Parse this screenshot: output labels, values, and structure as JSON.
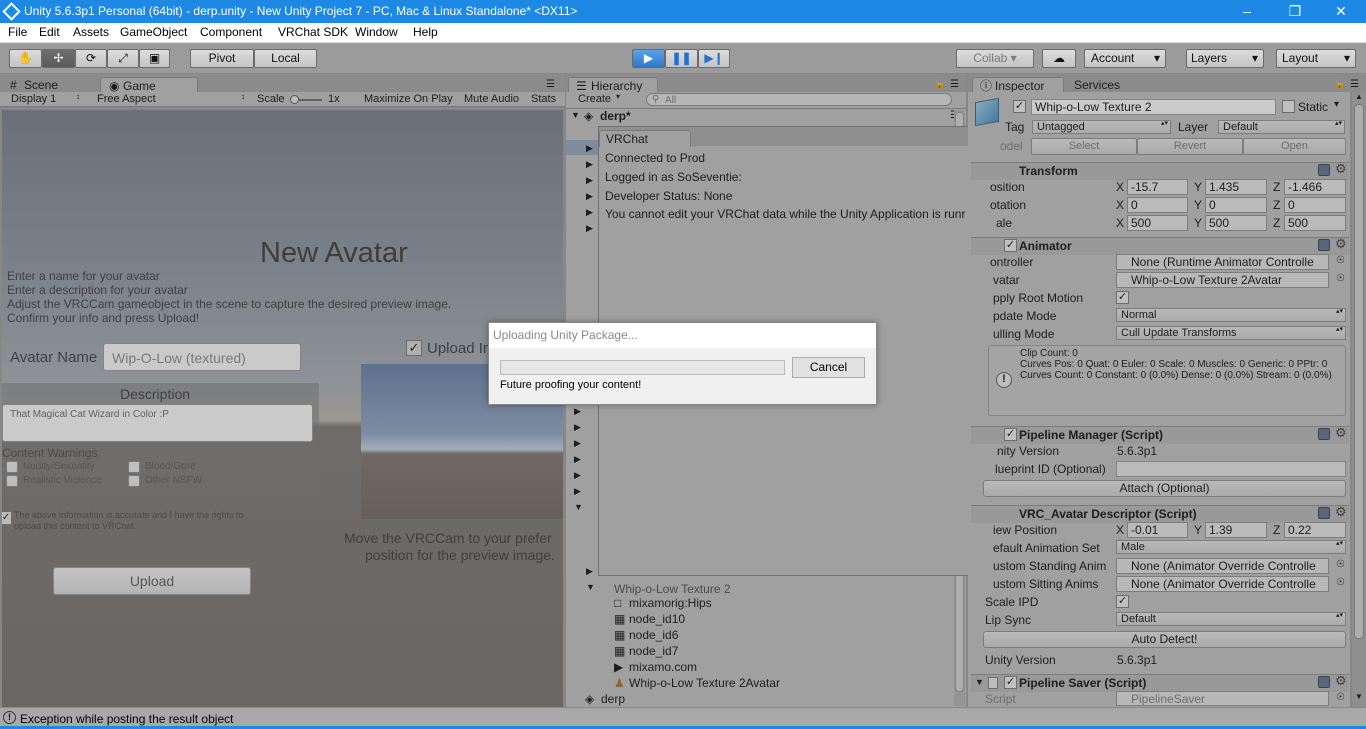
{
  "window": {
    "title": "Unity 5.6.3p1 Personal (64bit) - derp.unity - New Unity Project 7 - PC, Mac & Linux Standalone* <DX11>"
  },
  "menu": [
    "File",
    "Edit",
    "Assets",
    "GameObject",
    "Component",
    "VRChat SDK",
    "Window",
    "Help"
  ],
  "toolbar": {
    "pivot": "Pivot",
    "local": "Local",
    "collab": "Collab",
    "account": "Account",
    "layers": "Layers",
    "layout": "Layout"
  },
  "tabs": {
    "scene": "Scene",
    "game": "Game",
    "hierarchy": "Hierarchy",
    "inspector": "Inspector",
    "services": "Services"
  },
  "gamebar": {
    "display": "Display 1",
    "aspect": "Free Aspect",
    "scale_label": "Scale",
    "scale_value": "1x",
    "maximize": "Maximize On Play",
    "mute": "Mute Audio",
    "stats": "Stats"
  },
  "game": {
    "title": "New Avatar",
    "instructions": [
      "Enter a name for your avatar",
      "Enter a description for your avatar",
      "Adjust the VRCCam gameobject in the scene to capture the desired preview image.",
      "Confirm your info and press Upload!"
    ],
    "name_label": "Avatar Name",
    "name_value": "Wip-O-Low (textured)",
    "upload_image_label": "Upload Im",
    "description_label": "Description",
    "description_value": "That Magical Cat Wizard in Color :P",
    "warnings_label": "Content Warnings",
    "warnings": [
      "Nudity/Sexuality",
      "Blood/Gore",
      "Realistic Violence",
      "Other NSFW"
    ],
    "rights_line1": "The above information is accurate and I have the rights to",
    "rights_line2": "upload this content to VRChat.",
    "move_line1": "Move the VRCCam to your prefer",
    "move_line2": "position for the preview image.",
    "upload_button": "Upload"
  },
  "hierarchy": {
    "create": "Create",
    "search_placeholder": "All",
    "scene": "derp*",
    "items": [
      "mixamorig:Hips",
      "node_id10",
      "node_id6",
      "node_id7",
      "mixamo.com",
      "Whip-o-Low Texture 2Avatar"
    ],
    "parent_partial": "Whip-o-Low Texture 2",
    "root": "derp"
  },
  "vrchat": {
    "title": "VRChat",
    "lines": [
      "Connected to Prod",
      "Logged in as SoSeventie:",
      "Developer Status: None",
      "You cannot edit your VRChat data while the Unity Application is runr"
    ]
  },
  "upload_dialog": {
    "title": "Uploading Unity Package...",
    "message": "Future proofing your content!",
    "cancel": "Cancel",
    "progress": 0.0
  },
  "inspector": {
    "object_name": "Whip-o-Low Texture 2",
    "static": "Static",
    "tag_label": "Tag",
    "tag_value": "Untagged",
    "layer_label": "Layer",
    "layer_value": "Default",
    "model_label": "odel",
    "select": "Select",
    "revert": "Revert",
    "open": "Open",
    "transform": {
      "title": "Transform",
      "position_label": "osition",
      "rotation_label": "otation",
      "scale_label": "ale",
      "pos": [
        "-15.7",
        "1.435",
        "-1.466"
      ],
      "rot": [
        "0",
        "0",
        "0"
      ],
      "scl": [
        "500",
        "500",
        "500"
      ]
    },
    "axes": [
      "X",
      "Y",
      "Z"
    ],
    "animator": {
      "title": "Animator",
      "controller_label": "ontroller",
      "controller_value": "None (Runtime Animator Controlle",
      "avatar_label": "vatar",
      "avatar_value": "Whip-o-Low Texture 2Avatar",
      "root_motion_label": "pply Root Motion",
      "update_label": "pdate Mode",
      "update_value": "Normal",
      "culling_label": "ulling Mode",
      "culling_value": "Cull Update Transforms",
      "info": "Clip Count: 0\nCurves Pos: 0 Quat: 0 Euler: 0 Scale: 0 Muscles: 0 Generic: 0 PPtr: 0\nCurves Count: 0 Constant: 0 (0.0%) Dense: 0 (0.0%) Stream: 0 (0.0%)"
    },
    "pipeline": {
      "title": "Pipeline Manager (Script)",
      "unity_label": "nity Version",
      "unity_value": "5.6.3p1",
      "blueprint_label": "lueprint ID (Optional)",
      "attach": "Attach (Optional)"
    },
    "descriptor": {
      "title": "VRC_Avatar Descriptor (Script)",
      "view_label": "iew Position",
      "view": [
        "-0.01",
        "1.39",
        "0.22"
      ],
      "anim_set_label": "efault Animation Set",
      "anim_set_value": "Male",
      "standing_label": "ustom Standing Anim",
      "standing_value": "None (Animator Override Controlle",
      "sitting_label": "ustom Sitting Anims",
      "sitting_value": "None (Animator Override Controlle",
      "ipd_label": "Scale IPD",
      "lipsync_label": "Lip Sync",
      "lipsync_value": "Default",
      "autodetect": "Auto Detect!",
      "unity_label": "Unity Version",
      "unity_value": "5.6.3p1"
    },
    "saver": {
      "title": "Pipeline Saver (Script)",
      "script_label": "Script",
      "script_value": "PipelineSaver"
    }
  },
  "status": {
    "message": "Exception while posting the result object"
  }
}
